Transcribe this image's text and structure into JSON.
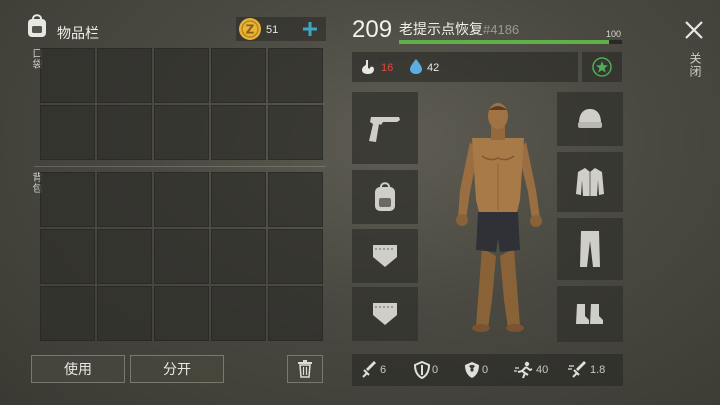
{
  "inventory": {
    "title": "物品栏",
    "coins": "51",
    "pocket_label": "口袋",
    "backpack_label": "背包",
    "use_label": "使用",
    "split_label": "分开"
  },
  "player": {
    "level": "209",
    "name": "老提示点恢复",
    "id": "#4186",
    "xp_max": "100",
    "xp_fraction": 0.94,
    "hunger": "16",
    "thirst": "42"
  },
  "stats": {
    "attack": "6",
    "armor": "0",
    "radiation": "0",
    "speed": "40",
    "attack_speed": "1.8"
  },
  "close_label": "关闭",
  "colors": {
    "xp_bar": "#5fb04a",
    "hunger_value": "#e04a3c",
    "thirst_icon": "#5aaee0",
    "add_button": "#3fa7c2",
    "coin": "#e8b43a"
  }
}
